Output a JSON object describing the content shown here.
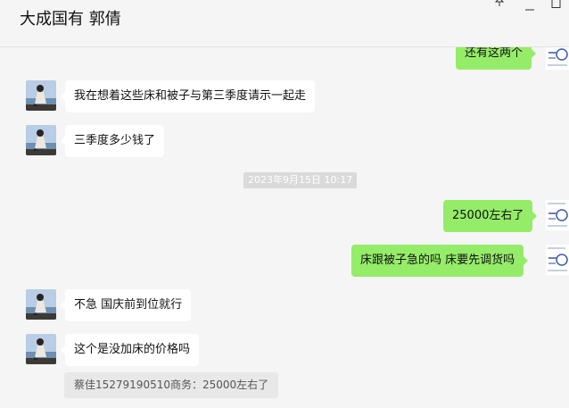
{
  "header": {
    "title": "大成国有 郭倩",
    "pin_icon": "pin-icon",
    "minimize_icon": "minimize-icon",
    "maximize_icon": "maximize-icon"
  },
  "messages": [
    {
      "side": "out",
      "text": "还有这两个"
    },
    {
      "side": "in",
      "text": "我在想着这些床和被子与第三季度请示一起走"
    },
    {
      "side": "in",
      "text": "三季度多少钱了"
    },
    {
      "side": "out",
      "text": "25000左右了"
    },
    {
      "side": "out",
      "text": "床跟被子急的吗 床要先调货吗"
    },
    {
      "side": "in",
      "text": "不急 国庆前到位就行"
    },
    {
      "side": "in",
      "text": "这个是没加床的价格吗"
    }
  ],
  "timestamp": "2023年9月15日 10:17",
  "quote": "蔡佳15279190510商务：25000左右了",
  "colors": {
    "background": "#f5f5f5",
    "outgoing_bubble": "#95ec69",
    "incoming_bubble": "#ffffff",
    "timestamp_bg": "#dadada"
  }
}
